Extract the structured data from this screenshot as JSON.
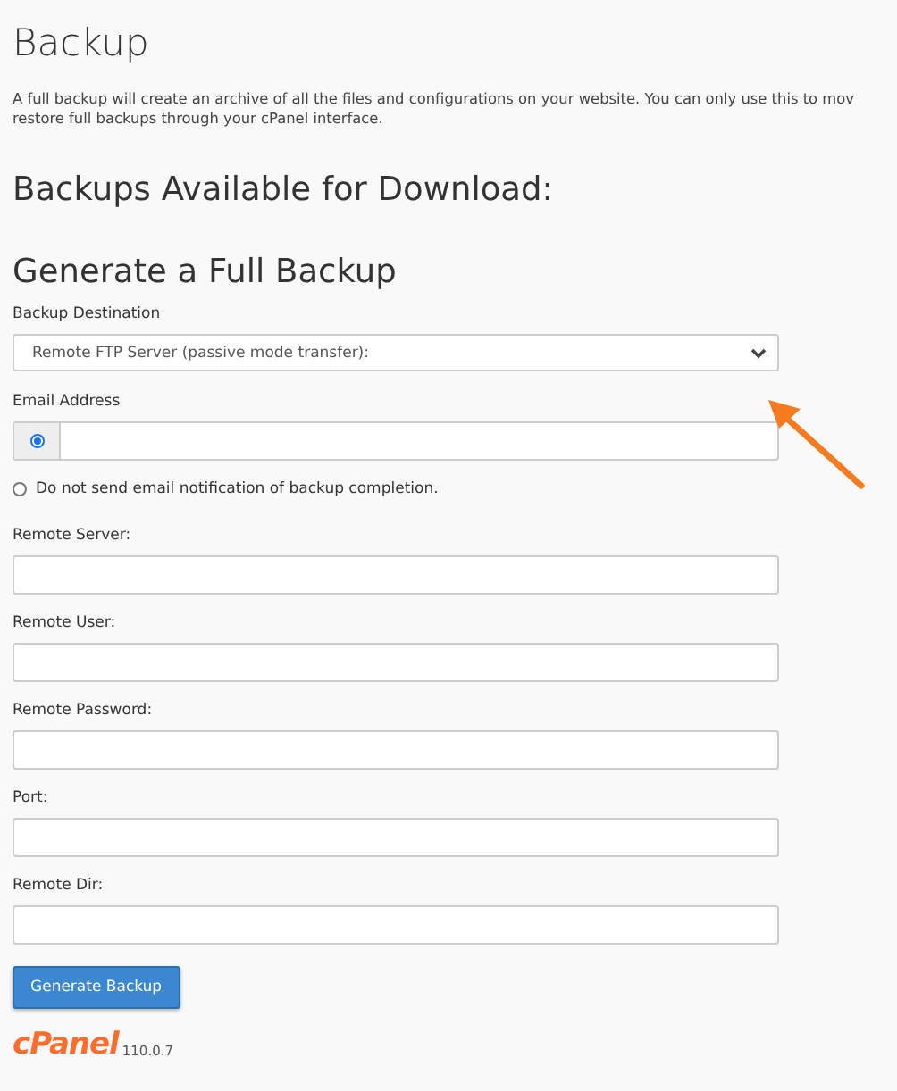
{
  "title": "Backup",
  "description": [
    "A full backup will create an archive of all the files and configurations on your website. You can only use this to mov",
    "restore full backups through your cPanel interface."
  ],
  "available_heading": "Backups Available for Download:",
  "generate_heading": "Generate a Full Backup",
  "destination": {
    "label": "Backup Destination",
    "value": "Remote FTP Server (passive mode transfer):"
  },
  "email": {
    "label": "Email Address",
    "selected": true
  },
  "no_email": {
    "label": "Do not send email notification of backup completion.",
    "selected": false
  },
  "fields": [
    {
      "label": "Remote Server:"
    },
    {
      "label": "Remote User:"
    },
    {
      "label": "Remote Password:"
    },
    {
      "label": "Port:"
    },
    {
      "label": "Remote Dir:"
    }
  ],
  "button": "Generate Backup",
  "footer": {
    "logo": "cPanel",
    "version": "110.0.7"
  }
}
